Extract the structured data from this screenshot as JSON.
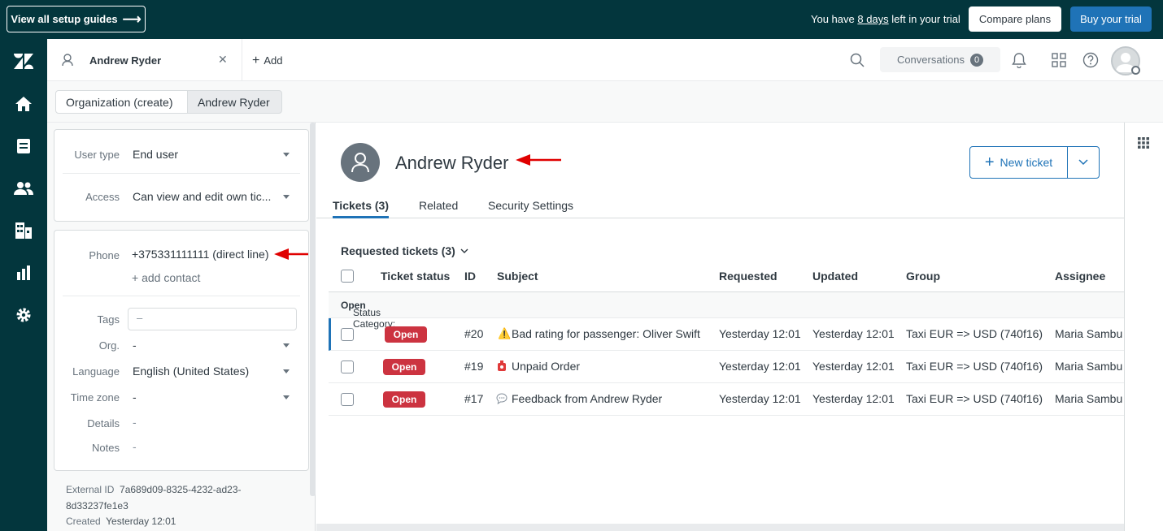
{
  "topbar": {
    "guides_label": "View all setup guides",
    "trial_prefix": "You have ",
    "trial_days": "8 days",
    "trial_suffix": " left in your trial",
    "compare_label": "Compare plans",
    "buy_label": "Buy your trial"
  },
  "nav": {
    "items": [
      "zendesk-logo-icon",
      "home-icon",
      "views-icon",
      "customers-icon",
      "organizations-icon",
      "reporting-icon",
      "admin-gear-icon"
    ]
  },
  "header": {
    "tab_name": "Andrew Ryder",
    "close_glyph": "✕",
    "add_label": "Add",
    "conversations_label": "Conversations",
    "conversations_count": "0"
  },
  "breadcrumbs": {
    "org": "Organization (create)",
    "user": "Andrew Ryder"
  },
  "sidebar": {
    "user_type_label": "User type",
    "user_type_value": "End user",
    "access_label": "Access",
    "access_value": "Can view and edit own tic...",
    "phone_label": "Phone",
    "phone_value": "+375331111111 (direct line)",
    "add_contact": "+ add contact",
    "tags_label": "Tags",
    "tags_value": "–",
    "org_label": "Org.",
    "org_value": "-",
    "language_label": "Language",
    "language_value": "English (United States)",
    "timezone_label": "Time zone",
    "timezone_value": "-",
    "details_label": "Details",
    "details_value": "-",
    "notes_label": "Notes",
    "notes_value": "-",
    "external_id_label": "External ID",
    "external_id_value_1": "7a689d09-8325-4232-ad23-",
    "external_id_value_2": "8d33237fe1e3",
    "created_label": "Created",
    "created_value": "Yesterday 12:01"
  },
  "main": {
    "name": "Andrew Ryder",
    "new_ticket_label": "New ticket",
    "tabs": [
      {
        "label": "Tickets (3)"
      },
      {
        "label": "Related"
      },
      {
        "label": "Security Settings"
      }
    ],
    "requested_title": "Requested tickets (3)",
    "columns": [
      "Ticket status",
      "ID",
      "Subject",
      "Requested",
      "Updated",
      "Group",
      "Assignee"
    ],
    "status_category_label": "Status Category:",
    "status_category_value": "Open",
    "rows": [
      {
        "status": "Open",
        "id": "#20",
        "icon": "warning-icon",
        "subject": "Bad rating for passenger: Oliver Swift",
        "requested": "Yesterday 12:01",
        "updated": "Yesterday 12:01",
        "group": "Taxi EUR => USD (740f16)",
        "assignee": "Maria Sambu"
      },
      {
        "status": "Open",
        "id": "#19",
        "icon": "alarm-icon",
        "subject": "Unpaid Order",
        "requested": "Yesterday 12:01",
        "updated": "Yesterday 12:01",
        "group": "Taxi EUR => USD (740f16)",
        "assignee": "Maria Sambu"
      },
      {
        "status": "Open",
        "id": "#17",
        "icon": "speech-bubble-icon",
        "subject": "Feedback from Andrew Ryder",
        "requested": "Yesterday 12:01",
        "updated": "Yesterday 12:01",
        "group": "Taxi EUR => USD (740f16)",
        "assignee": "Maria Sambu"
      }
    ]
  },
  "colors": {
    "topbar": "#03363d",
    "accent": "#1f73b7",
    "open_badge": "#cc3340",
    "annotation_arrow": "#e00000"
  }
}
